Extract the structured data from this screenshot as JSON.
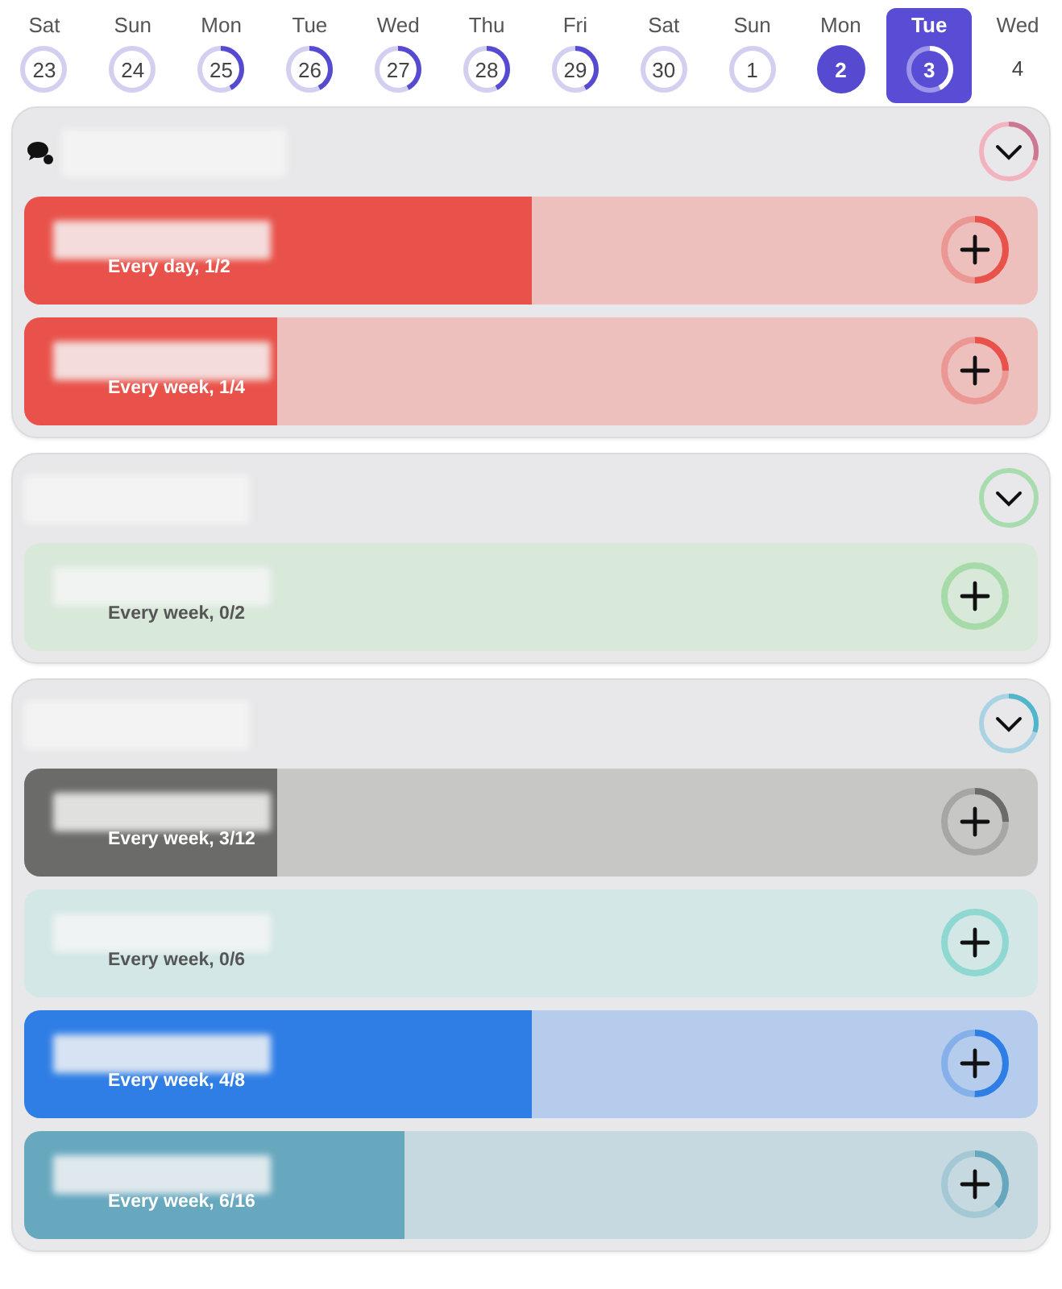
{
  "days": [
    {
      "weekday": "Sat",
      "date": "23",
      "kind": "empty",
      "selected": false
    },
    {
      "weekday": "Sun",
      "date": "24",
      "kind": "empty",
      "selected": false
    },
    {
      "weekday": "Mon",
      "date": "25",
      "kind": "partial",
      "selected": false
    },
    {
      "weekday": "Tue",
      "date": "26",
      "kind": "partial",
      "selected": false
    },
    {
      "weekday": "Wed",
      "date": "27",
      "kind": "partial",
      "selected": false
    },
    {
      "weekday": "Thu",
      "date": "28",
      "kind": "partial",
      "selected": false
    },
    {
      "weekday": "Fri",
      "date": "29",
      "kind": "partial",
      "selected": false
    },
    {
      "weekday": "Sat",
      "date": "30",
      "kind": "empty",
      "selected": false
    },
    {
      "weekday": "Sun",
      "date": "1",
      "kind": "empty",
      "selected": false
    },
    {
      "weekday": "Mon",
      "date": "2",
      "kind": "complete",
      "selected": false
    },
    {
      "weekday": "Tue",
      "date": "3",
      "kind": "partial",
      "selected": true
    },
    {
      "weekday": "Wed",
      "date": "4",
      "kind": "plain",
      "selected": false
    }
  ],
  "groups": [
    {
      "icon": true,
      "color": "#f2b3be",
      "kind": "partial",
      "habits": [
        {
          "subtitle": "Every day, 1/2",
          "color": "#e9524a",
          "level": 0.5
        },
        {
          "subtitle": "Every week, 1/4",
          "color": "#e9524a",
          "level": 0.25
        }
      ]
    },
    {
      "color": "#a8dcae",
      "kind": "empty",
      "habits": [
        {
          "subtitle": "Every week, 0/2",
          "color": "#a6dba9",
          "level": 0
        }
      ]
    },
    {
      "color": "#a9d3e2",
      "kind": "partial",
      "habits": [
        {
          "subtitle": "Every week, 3/12",
          "color": "#6b6b69",
          "level": 0.25
        },
        {
          "subtitle": "Every week, 0/6",
          "color": "#8fd8d2",
          "level": 0
        },
        {
          "subtitle": "Every week, 4/8",
          "color": "#2f7ee6",
          "level": 0.5
        },
        {
          "subtitle": "Every week, 6/16",
          "color": "#67a8bf",
          "level": 0.375
        }
      ]
    }
  ]
}
